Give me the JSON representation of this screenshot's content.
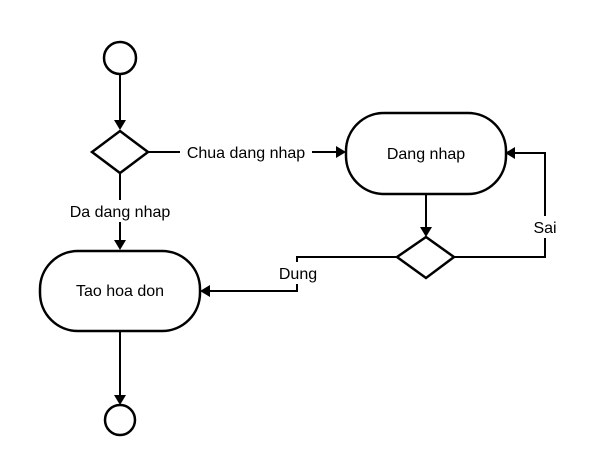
{
  "diagram": {
    "nodes": {
      "start": {
        "kind": "initial"
      },
      "login_check": {
        "kind": "decision"
      },
      "login": {
        "kind": "action",
        "label": "Dang nhap"
      },
      "login_result": {
        "kind": "decision"
      },
      "create_invoice": {
        "kind": "action",
        "label": "Tao hoa don"
      },
      "end": {
        "kind": "final"
      }
    },
    "edges": {
      "start_to_check": {
        "from": "start",
        "to": "login_check",
        "label": ""
      },
      "not_logged_in": {
        "from": "login_check",
        "to": "login",
        "label": "Chua dang nhap"
      },
      "logged_in": {
        "from": "login_check",
        "to": "create_invoice",
        "label": "Da dang nhap"
      },
      "login_to_result": {
        "from": "login",
        "to": "login_result",
        "label": ""
      },
      "success": {
        "from": "login_result",
        "to": "create_invoice",
        "label": "Dung"
      },
      "failure": {
        "from": "login_result",
        "to": "login",
        "label": "Sai"
      },
      "invoice_to_end": {
        "from": "create_invoice",
        "to": "end",
        "label": ""
      }
    }
  }
}
